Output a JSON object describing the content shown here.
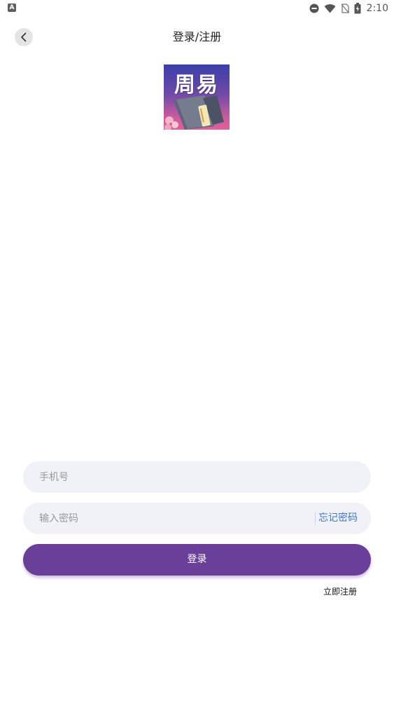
{
  "status_bar": {
    "app_icon_letter": "A",
    "time": "2:10",
    "icons": [
      "do-not-disturb-icon",
      "wifi-icon",
      "no-sim-icon",
      "battery-charging-icon"
    ]
  },
  "header": {
    "title": "登录/注册",
    "back_icon": "chevron-left-icon"
  },
  "logo": {
    "text": "周易",
    "colors": {
      "top": "#3b3fa8",
      "bottom": "#e0609a",
      "book": "#6b7283"
    }
  },
  "form": {
    "phone_placeholder": "手机号",
    "password_placeholder": "输入密码",
    "forgot_label": "忘记密码",
    "login_label": "登录",
    "register_label": "立即注册"
  },
  "colors": {
    "primary": "#6a3f9a",
    "field_bg": "#f1f1f8",
    "link": "#3d78c9"
  }
}
